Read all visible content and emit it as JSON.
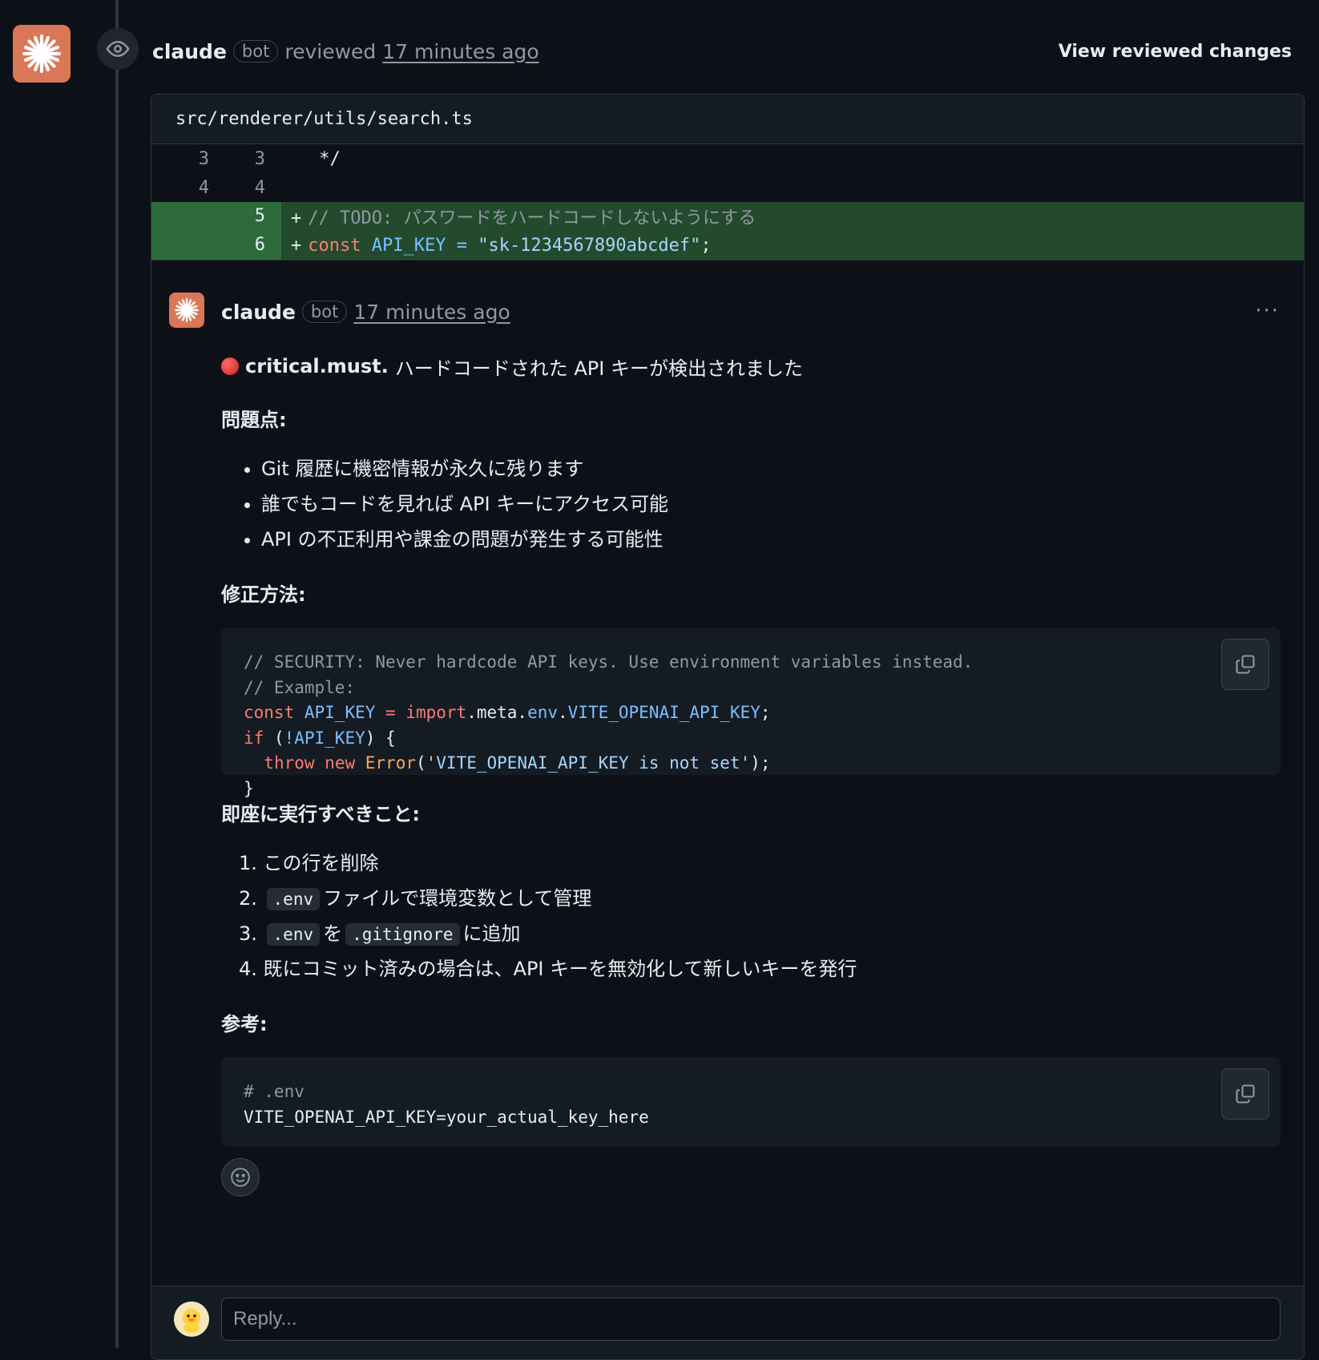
{
  "review": {
    "author": "claude",
    "badge": "bot",
    "action": "reviewed",
    "time": "17 minutes ago",
    "view_changes": "View reviewed changes"
  },
  "file": {
    "path": "src/renderer/utils/search.ts",
    "lines": [
      {
        "old": "3",
        "new": "3",
        "sign": "",
        "text": " */",
        "type": "context"
      },
      {
        "old": "4",
        "new": "4",
        "sign": "",
        "text": "",
        "type": "context"
      },
      {
        "old": "",
        "new": "5",
        "sign": "+",
        "text": "// TODO: パスワードをハードコードしないようにする",
        "type": "add"
      },
      {
        "old": "",
        "new": "6",
        "sign": "+",
        "tokens": {
          "kw": "const",
          "var": "API_KEY",
          "eq": "=",
          "str": "\"sk-1234567890abcdef\"",
          "end": ";"
        },
        "type": "add"
      }
    ]
  },
  "comment": {
    "author": "claude",
    "badge": "bot",
    "time": "17 minutes ago",
    "more": "···",
    "title_bold": "critical.must.",
    "title_rest": "ハードコードされた API キーが検出されました",
    "problems_heading": "問題点:",
    "problems": [
      "Git 履歴に機密情報が永久に残ります",
      "誰でもコードを見れば API キーにアクセス可能",
      "API の不正利用や課金の問題が発生する可能性"
    ],
    "fix_heading": "修正方法:",
    "fix_code": {
      "l1": "// SECURITY: Never hardcode API keys. Use environment variables instead.",
      "l2": "// Example:",
      "l3_kw": "const",
      "l3_var": "API_KEY",
      "l3_eq": "=",
      "l3_import": "import",
      "l3_meta": ".meta.",
      "l3_env": "env",
      "l3_dot": ".",
      "l3_key": "VITE_OPENAI_API_KEY",
      "l3_end": ";",
      "l4_kw": "if",
      "l4_open": " (",
      "l4_var": "!API_KEY",
      "l4_close": ") {",
      "l5_throw": "throw",
      "l5_new": "new",
      "l5_err": "Error",
      "l5_open": "(",
      "l5_str": "'VITE_OPENAI_API_KEY is not set'",
      "l5_end": ");",
      "l6": "}"
    },
    "todo_heading": "即座に実行すべきこと:",
    "todo": {
      "i1": "この行を削除",
      "i2_code": ".env",
      "i2_text": "ファイルで環境変数として管理",
      "i3_code1": ".env",
      "i3_mid": "を",
      "i3_code2": ".gitignore",
      "i3_text": "に追加",
      "i4": "既にコミット済みの場合は、API キーを無効化して新しいキーを発行"
    },
    "ref_heading": "参考:",
    "ref_code": {
      "l1": "# .env",
      "l2": "VITE_OPENAI_API_KEY=your_actual_key_here"
    }
  },
  "reply": {
    "placeholder": "Reply..."
  },
  "icons": {
    "avatar": "claude-sparkle-icon",
    "eye": "eye-icon",
    "copy": "copy-icon",
    "emoji": "smiley-icon",
    "reply_avatar": "duck-avatar"
  },
  "colors": {
    "brand": "#d97757",
    "add_bg": "#234a2d",
    "keyword": "#ff7b72",
    "identifier": "#79c0ff",
    "string": "#a5d6ff"
  }
}
